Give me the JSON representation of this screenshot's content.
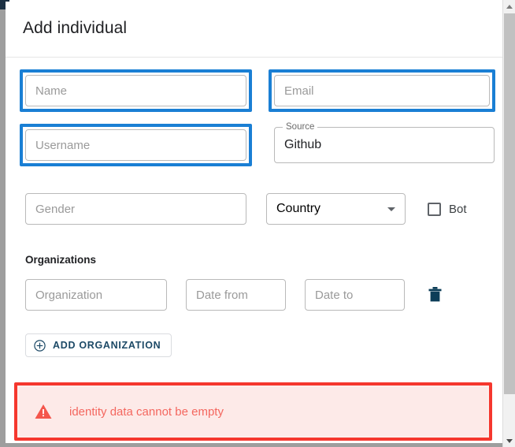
{
  "dialog": {
    "title": "Add individual"
  },
  "fields": {
    "name": {
      "placeholder": "Name",
      "value": "",
      "focused": true
    },
    "email": {
      "placeholder": "Email",
      "value": "",
      "focused": true
    },
    "username": {
      "placeholder": "Username",
      "value": "",
      "focused": true
    },
    "source": {
      "label": "Source",
      "value": "Github"
    },
    "gender": {
      "placeholder": "Gender",
      "value": ""
    },
    "country": {
      "placeholder": "Country",
      "value": ""
    },
    "bot": {
      "label": "Bot",
      "checked": false
    }
  },
  "organizations": {
    "section_label": "Organizations",
    "rows": [
      {
        "organization_placeholder": "Organization",
        "organization_value": "",
        "date_from_placeholder": "Date from",
        "date_from_value": "",
        "date_to_placeholder": "Date to",
        "date_to_value": "",
        "delete_icon": "trash-icon"
      }
    ],
    "add_button_label": "ADD ORGANIZATION",
    "add_button_icon": "plus-circle-icon"
  },
  "alert": {
    "icon": "warning-triangle-icon",
    "message": "identity data cannot be empty",
    "border_color": "#f5372e",
    "background_color": "#fdeae8",
    "text_color": "#f4675f"
  },
  "scrollbar": {
    "up_arrow_icon": "chevron-up-icon",
    "down_arrow_icon": "chevron-down-icon"
  },
  "colors": {
    "focus_ring": "#1a7fd4",
    "accent_navy": "#1c4966",
    "error": "#f5372e"
  }
}
